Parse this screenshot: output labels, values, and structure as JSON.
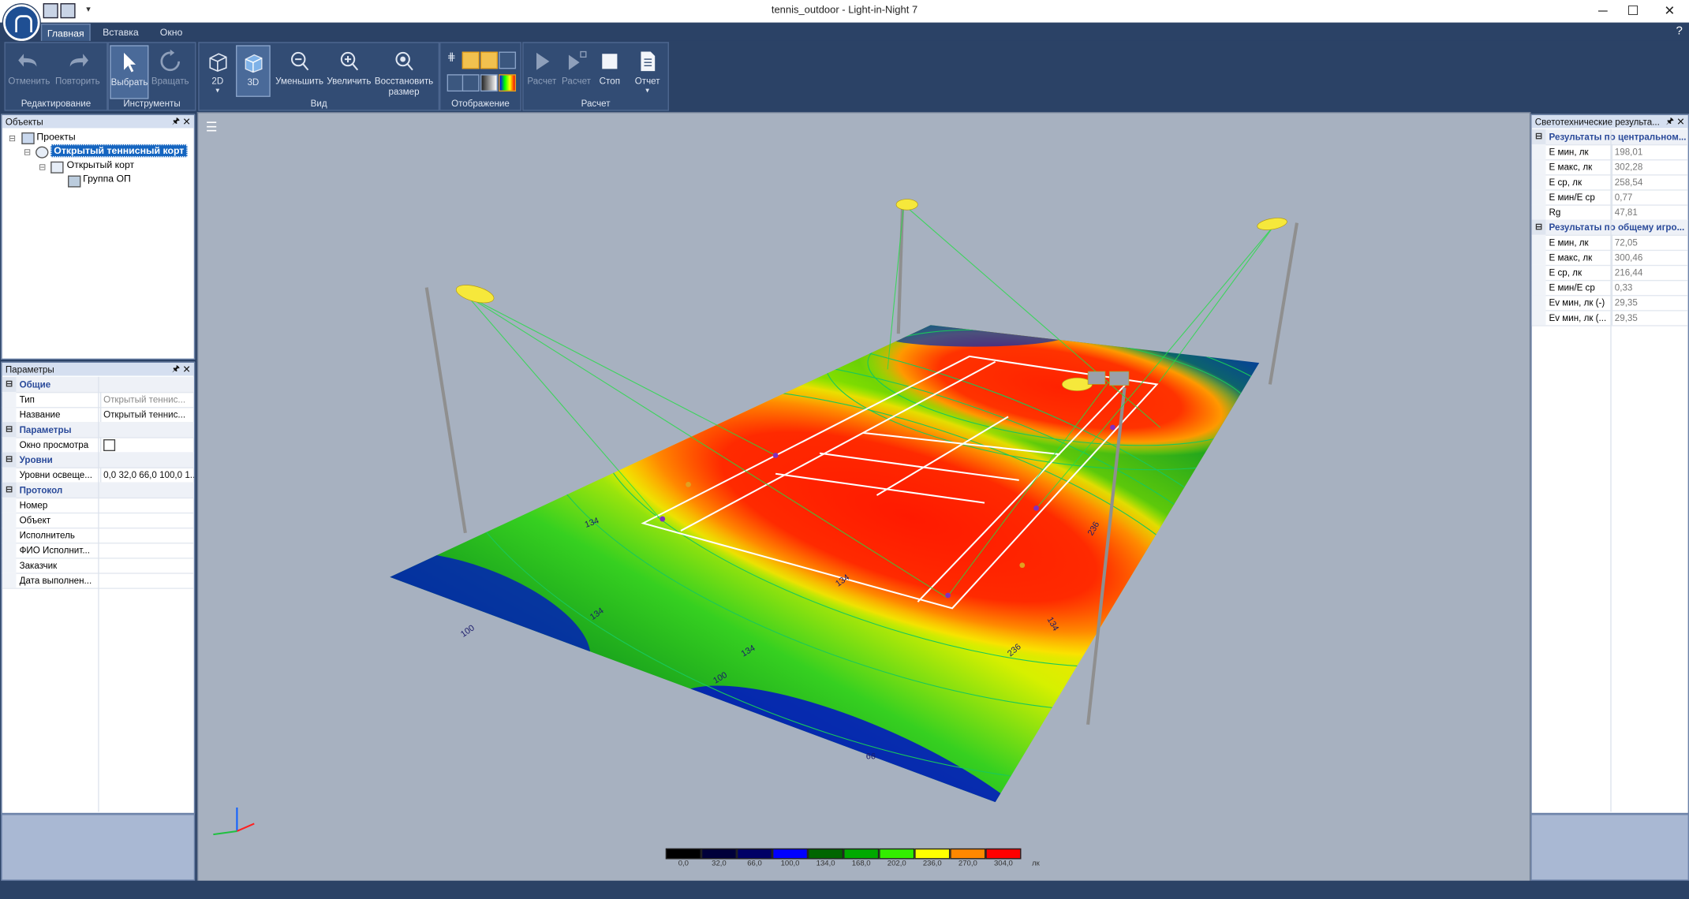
{
  "window": {
    "title": "tennis_outdoor - Light-in-Night 7",
    "controls": [
      "─",
      "☐",
      "✕"
    ]
  },
  "ribbon": {
    "tabs": [
      "Главная",
      "Вставка",
      "Окно"
    ],
    "active_tab": "Главная",
    "help": "?",
    "groups": {
      "editing": {
        "label": "Редактирование",
        "undo": "Отменить",
        "redo": "Повторить"
      },
      "tools": {
        "label": "Инструменты",
        "select": "Выбрать",
        "rotate": "Вращать"
      },
      "view": {
        "label": "Вид",
        "btn_2d": "2D",
        "btn_3d": "3D",
        "zoom_out": "Уменьшить",
        "zoom_in": "Увеличить",
        "restore_1": "Восстановить",
        "restore_2": "размер"
      },
      "display": {
        "label": "Отображение"
      },
      "calc": {
        "label": "Расчет",
        "calc1": "Расчет",
        "calc2": "Расчет",
        "stop": "Стоп",
        "report": "Отчет"
      }
    }
  },
  "objects_panel": {
    "title": "Объекты",
    "tree": [
      {
        "label": "Проекты",
        "level": 0
      },
      {
        "label": "Открытый теннисный корт",
        "level": 1,
        "selected": true
      },
      {
        "label": "Открытый корт",
        "level": 2
      },
      {
        "label": "Группа ОП",
        "level": 3
      }
    ]
  },
  "params_panel": {
    "title": "Параметры",
    "rows": [
      {
        "type": "cat",
        "label": "Общие"
      },
      {
        "label": "Тип",
        "value": "Открытый теннис..."
      },
      {
        "label": "Название",
        "value": "Открытый теннис...",
        "dark": true
      },
      {
        "type": "cat",
        "label": "Параметры"
      },
      {
        "label": "Окно просмотра",
        "value": "",
        "checkbox": true
      },
      {
        "type": "cat",
        "label": "Уровни"
      },
      {
        "label": "Уровни освеще...",
        "value": "0,0 32,0 66,0 100,0 1...",
        "dark": true
      },
      {
        "type": "cat",
        "label": "Протокол"
      },
      {
        "label": "Номер",
        "value": ""
      },
      {
        "label": "Объект",
        "value": ""
      },
      {
        "label": "Исполнитель",
        "value": ""
      },
      {
        "label": "ФИО Исполнит...",
        "value": ""
      },
      {
        "label": "Заказчик",
        "value": ""
      },
      {
        "label": "Дата выполнен...",
        "value": ""
      }
    ]
  },
  "results_panel": {
    "title": "Светотехнические результа...",
    "sections": [
      {
        "label": "Результаты по центральном...",
        "rows": [
          {
            "label": "E мин, лк",
            "value": "198,01"
          },
          {
            "label": "E макс, лк",
            "value": "302,28"
          },
          {
            "label": "E ср, лк",
            "value": "258,54"
          },
          {
            "label": "E мин/E ср",
            "value": "0,77"
          },
          {
            "label": "Rg",
            "value": "47,81"
          }
        ]
      },
      {
        "label": "Результаты по общему игро...",
        "rows": [
          {
            "label": "E мин, лк",
            "value": "72,05"
          },
          {
            "label": "E макс, лк",
            "value": "300,46"
          },
          {
            "label": "E ср, лк",
            "value": "216,44"
          },
          {
            "label": "E мин/E ср",
            "value": "0,33"
          },
          {
            "label": "Ev мин, лк (-)",
            "value": "29,35"
          },
          {
            "label": "Ev мин, лк (...",
            "value": "29,35"
          }
        ]
      }
    ]
  },
  "viewport": {
    "menu_icon": "hamburger-icon",
    "contour_labels": [
      "100",
      "134",
      "134",
      "100",
      "66",
      "134",
      "236",
      "134",
      "236",
      "134"
    ],
    "legend": {
      "colors": [
        "#000000",
        "#00003a",
        "#000066",
        "#0000ff",
        "#006600",
        "#00aa00",
        "#33ee00",
        "#ffff00",
        "#ff8800",
        "#ff0000"
      ],
      "labels": [
        "0,0",
        "32,0",
        "66,0",
        "100,0",
        "134,0",
        "168,0",
        "202,0",
        "236,0",
        "270,0",
        "304,0"
      ],
      "unit": "лк"
    }
  }
}
